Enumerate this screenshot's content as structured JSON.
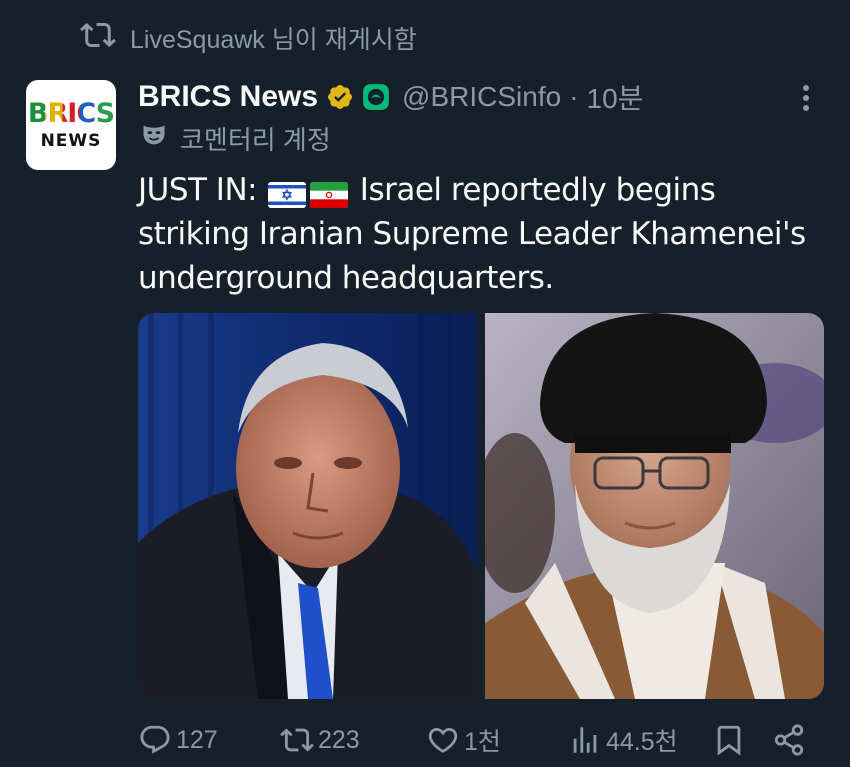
{
  "repost": {
    "label": "LiveSquawk 님이 재게시함",
    "icon": "repost-icon"
  },
  "author": {
    "avatar_text_top": "BRICS",
    "avatar_text_bottom": "NEWS",
    "display_name": "BRICS News",
    "handle": "@BRICSinfo",
    "separator": "·",
    "time": "10분",
    "verified_color": "#e2b719",
    "affiliate_color": "#00ba7c"
  },
  "label": {
    "text": "코멘터리 계정",
    "icon": "mask-icon"
  },
  "tweet": {
    "prefix": "JUST IN:",
    "flags": [
      "israel-flag",
      "iran-flag"
    ],
    "body": "Israel reportedly begins striking Iranian Supreme Leader Khamenei's underground headquarters."
  },
  "media": {
    "count": 2,
    "images": [
      "portrait-left",
      "portrait-right"
    ]
  },
  "actions": {
    "replies": "127",
    "reposts": "223",
    "likes": "1천",
    "views": "44.5천"
  },
  "colors": {
    "background": "#15202b",
    "text_primary": "#f7f9f9",
    "text_secondary": "#8b98a5"
  }
}
